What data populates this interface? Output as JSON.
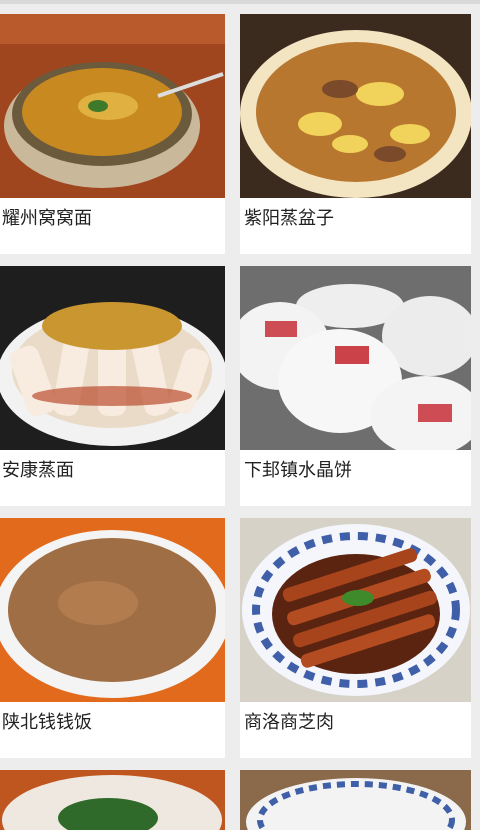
{
  "dishes": [
    {
      "name": "耀州窝窝面"
    },
    {
      "name": "紫阳蒸盆子"
    },
    {
      "name": "安康蒸面"
    },
    {
      "name": "下邽镇水晶饼"
    },
    {
      "name": "陕北钱钱饭"
    },
    {
      "name": "商洛商芝肉"
    }
  ]
}
